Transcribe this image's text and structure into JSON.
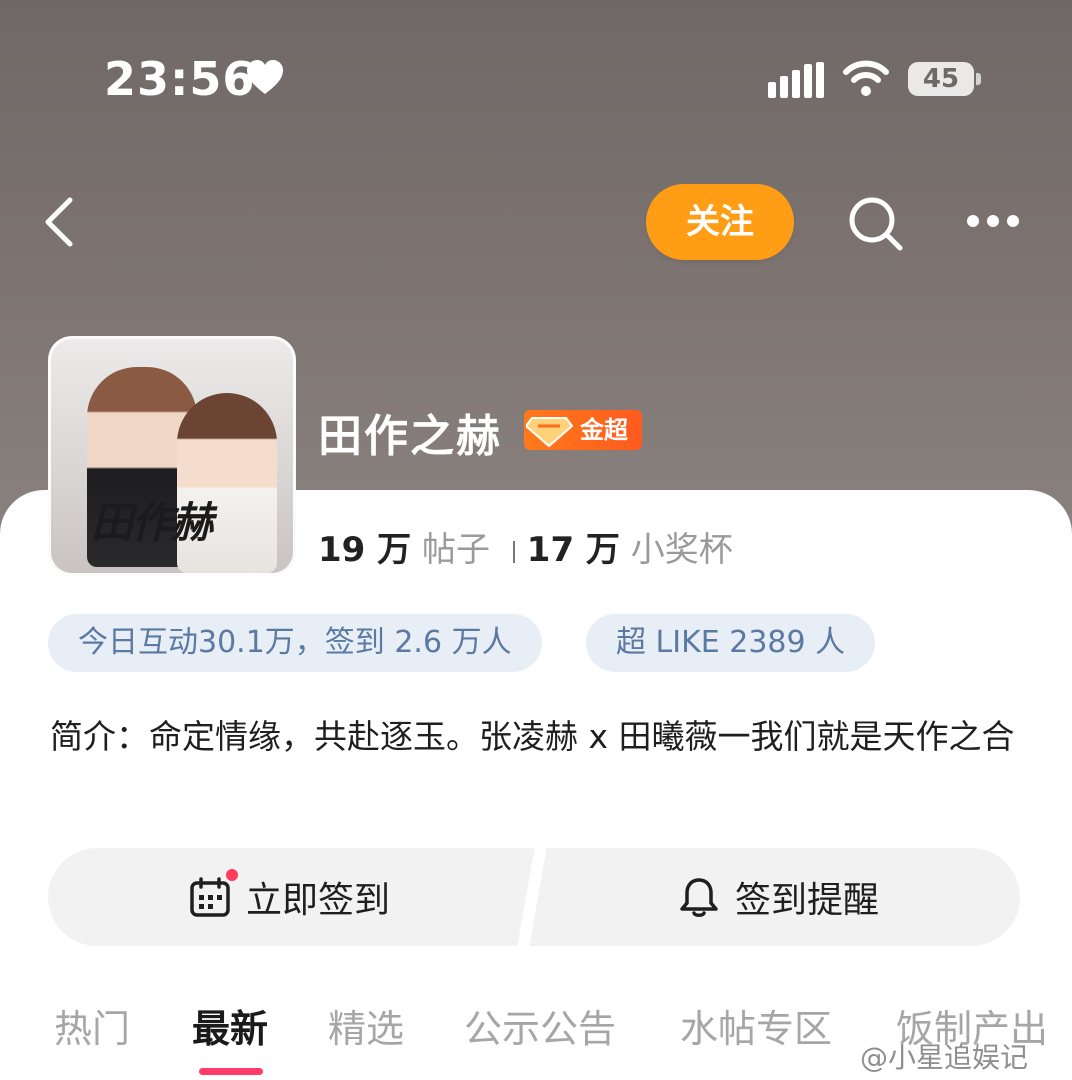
{
  "status_bar": {
    "time": "23:56",
    "battery": "45"
  },
  "nav": {
    "follow_label": "关注"
  },
  "forum": {
    "avatar_logo_text": "田作赫",
    "title": "田作之赫",
    "badge": "金超",
    "posts_count": "19 万",
    "posts_label": "帖子",
    "cups_count": "17 万",
    "cups_label": "小奖杯"
  },
  "pills": {
    "activity": "今日互动30.1万，签到 2.6 万人",
    "super_like": "超 LIKE 2389 人"
  },
  "intro": "简介：命定情缘，共赴逐玉。张凌赫 x 田曦薇一我们就是天作之合",
  "actions": {
    "checkin": "立即签到",
    "remind": "签到提醒"
  },
  "tabs": [
    "热门",
    "最新",
    "精选",
    "公示公告",
    "水帖专区",
    "饭制产出"
  ],
  "active_tab": "最新",
  "watermark": "@小星追娱记",
  "colors": {
    "accent_orange": "#ff9d14",
    "tab_underline": "#ff3b6b",
    "pill_text": "#5b7aa3"
  }
}
